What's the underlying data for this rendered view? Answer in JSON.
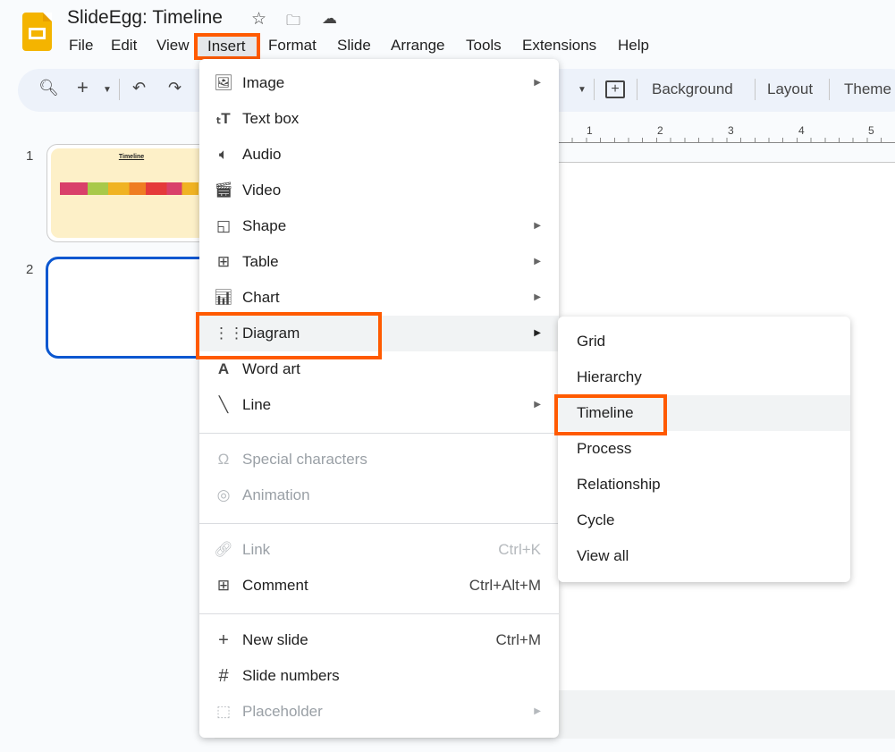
{
  "app": {
    "title": "SlideEgg: Timeline",
    "icons": [
      "star-icon",
      "move-to-folder-icon",
      "cloud-saved-icon"
    ]
  },
  "menubar": [
    "File",
    "Edit",
    "View",
    "Insert",
    "Format",
    "Slide",
    "Arrange",
    "Tools",
    "Extensions",
    "Help"
  ],
  "toolbar": {
    "background": "Background",
    "layout": "Layout",
    "theme": "Theme"
  },
  "ruler": [
    "1",
    "2",
    "3",
    "4",
    "5"
  ],
  "slides": [
    {
      "number": "1",
      "title": "Timeline"
    },
    {
      "number": "2"
    }
  ],
  "insert_menu": [
    {
      "label": "Image",
      "icon": "image-icon",
      "submenu": true
    },
    {
      "label": "Text box",
      "icon": "text-box-icon"
    },
    {
      "label": "Audio",
      "icon": "audio-icon"
    },
    {
      "label": "Video",
      "icon": "video-icon"
    },
    {
      "label": "Shape",
      "icon": "shape-icon",
      "submenu": true
    },
    {
      "label": "Table",
      "icon": "table-icon",
      "submenu": true
    },
    {
      "label": "Chart",
      "icon": "chart-icon",
      "submenu": true
    },
    {
      "label": "Diagram",
      "icon": "diagram-icon",
      "submenu": true,
      "highlighted": true
    },
    {
      "label": "Word art",
      "icon": "word-art-icon"
    },
    {
      "label": "Line",
      "icon": "line-icon",
      "submenu": true
    },
    {
      "label": "Special characters",
      "icon": "omega-icon",
      "disabled": true
    },
    {
      "label": "Animation",
      "icon": "animation-icon",
      "disabled": true
    },
    {
      "label": "Link",
      "icon": "link-icon",
      "shortcut": "Ctrl+K",
      "disabled": true
    },
    {
      "label": "Comment",
      "icon": "comment-icon",
      "shortcut": "Ctrl+Alt+M"
    },
    {
      "label": "New slide",
      "icon": "plus-icon",
      "shortcut": "Ctrl+M"
    },
    {
      "label": "Slide numbers",
      "icon": "hash-icon"
    },
    {
      "label": "Placeholder",
      "icon": "placeholder-icon",
      "submenu": true,
      "disabled": true
    }
  ],
  "diagram_submenu": [
    "Grid",
    "Hierarchy",
    "Timeline",
    "Process",
    "Relationship",
    "Cycle",
    "View all"
  ],
  "colors": {
    "highlight_box": "#ff5a00",
    "selected_slide": "#0b57d0",
    "toolbar_bg": "#edf2fa"
  }
}
